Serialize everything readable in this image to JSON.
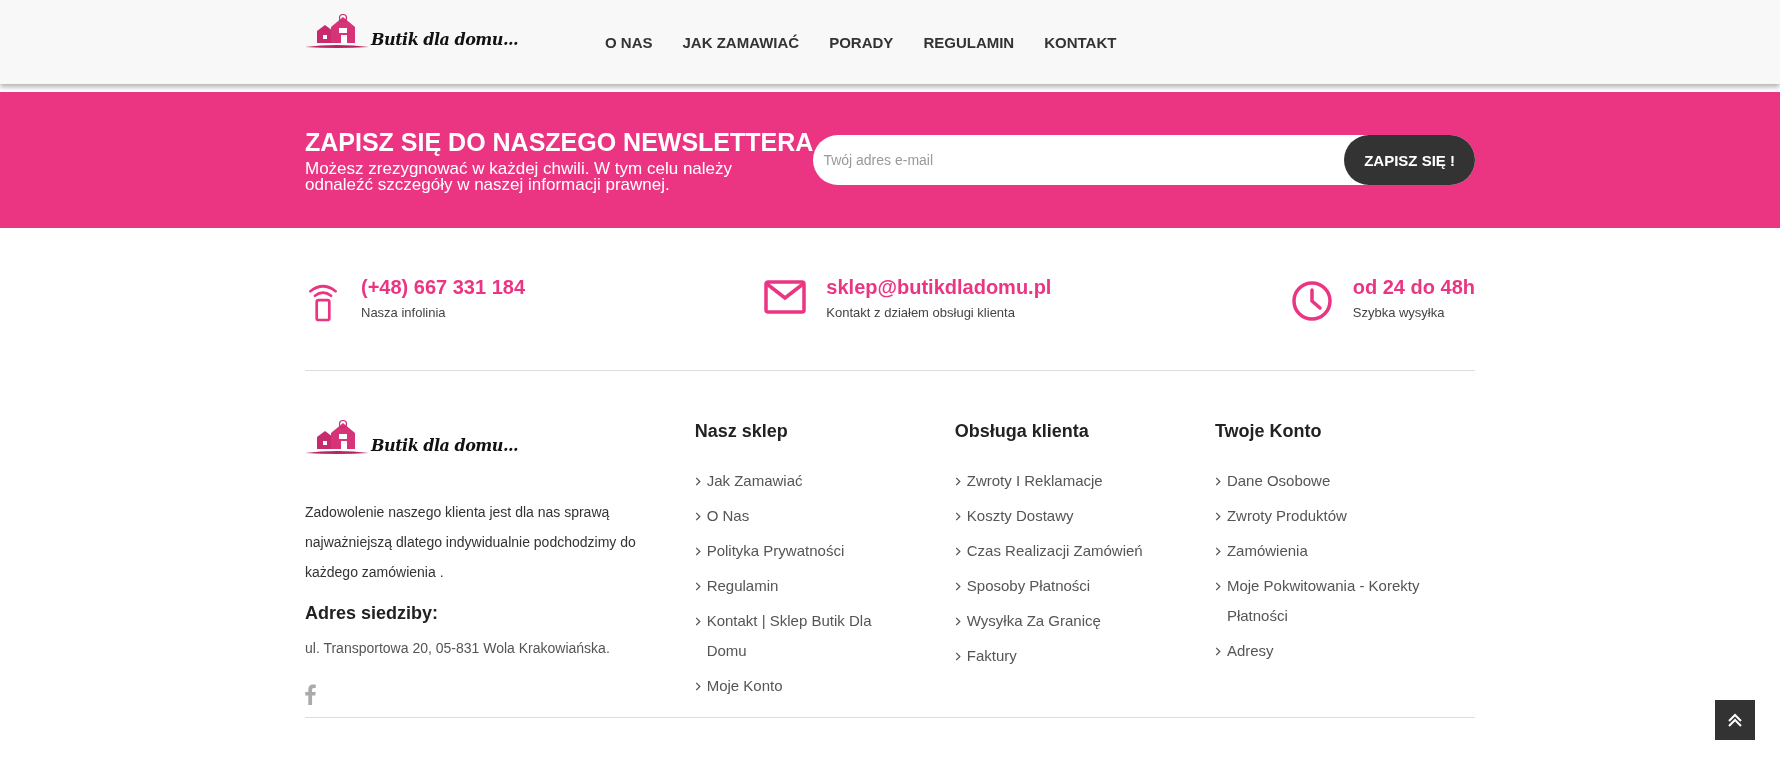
{
  "header": {
    "logo_text": "Butik dla domu...",
    "nav": [
      {
        "label": "O NAS"
      },
      {
        "label": "JAK ZAMAWIAĆ"
      },
      {
        "label": "PORADY"
      },
      {
        "label": "REGULAMIN"
      },
      {
        "label": "KONTAKT"
      }
    ]
  },
  "newsletter": {
    "title": "ZAPISZ SIĘ DO NASZEGO NEWSLETTERA",
    "text": "Możesz zrezygnować w każdej chwili. W tym celu należy odnaleźć szczegóły w naszej informacji prawnej.",
    "placeholder": "Twój adres e-mail",
    "button": "ZAPISZ SIĘ !"
  },
  "contacts": [
    {
      "kind": "phone",
      "value": "(+48) 667 331 184",
      "caption": "Nasza infolinia"
    },
    {
      "kind": "mail",
      "value": "sklep@butikdladomu.pl",
      "caption": "Kontakt z działem obsługi klienta"
    },
    {
      "kind": "clock",
      "value": "od 24 do 48h",
      "caption": "Szybka wysyłka"
    }
  ],
  "footer": {
    "logo_text": "Butik dla domu...",
    "about": "Zadowolenie naszego klienta jest dla nas sprawą najważniejszą dlatego indywidualnie podchodzimy do każdego zamówienia .",
    "address_title": "Adres siedziby:",
    "address": "ul. Transportowa 20, 05-831 Wola Krakowiańska.",
    "columns": [
      {
        "title": "Nasz sklep",
        "links": [
          "Jak Zamawiać",
          "O Nas",
          "Polityka Prywatności",
          "Regulamin",
          "Kontakt | Sklep Butik Dla Domu",
          "Moje Konto"
        ]
      },
      {
        "title": "Obsługa klienta",
        "links": [
          "Zwroty I Reklamacje",
          "Koszty Dostawy",
          "Czas Realizacji Zamówień",
          "Sposoby Płatności",
          "Wysyłka Za Granicę",
          "Faktury"
        ]
      },
      {
        "title": "Twoje Konto",
        "links": [
          "Dane Osobowe",
          "Zwroty Produktów",
          "Zamówienia",
          "Moje Pokwitowania - Korekty Płatności",
          "Adresy"
        ]
      }
    ]
  }
}
